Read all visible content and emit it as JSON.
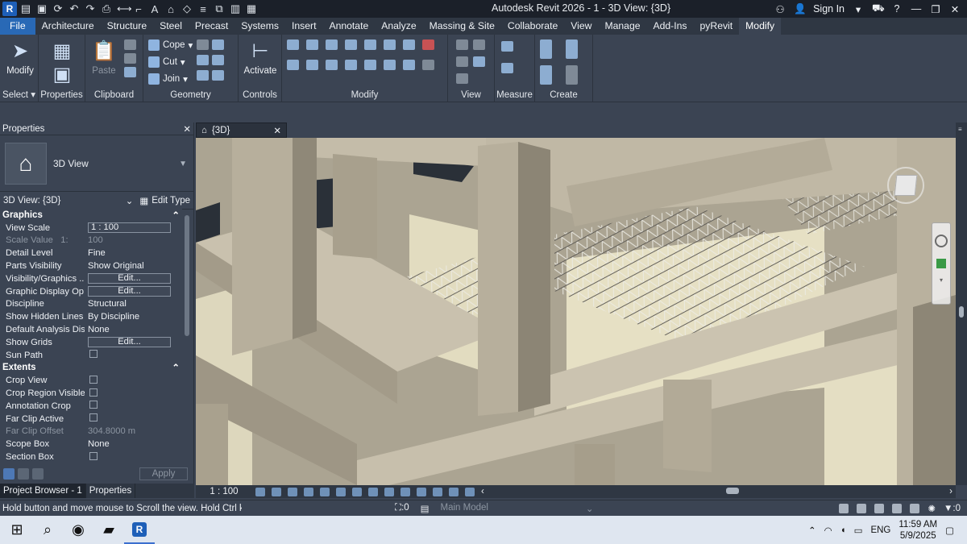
{
  "app": {
    "title": "Autodesk Revit 2026 - 1 - 3D View: {3D}",
    "logo_letter": "R",
    "sign_in": "Sign In"
  },
  "tabs": [
    "File",
    "Architecture",
    "Structure",
    "Steel",
    "Precast",
    "Systems",
    "Insert",
    "Annotate",
    "Analyze",
    "Massing & Site",
    "Collaborate",
    "View",
    "Manage",
    "Add-Ins",
    "pyRevit",
    "Modify"
  ],
  "active_tab": "Modify",
  "ribbon": {
    "select": {
      "modify_label": "Modify",
      "panel_label": "Select"
    },
    "properties": {
      "panel_label": "Properties"
    },
    "clipboard": {
      "paste_label": "Paste",
      "panel_label": "Clipboard"
    },
    "geometry": {
      "cope_label": "Cope",
      "cut_label": "Cut",
      "join_label": "Join",
      "panel_label": "Geometry"
    },
    "controls": {
      "activate_label": "Activate",
      "panel_label": "Controls"
    },
    "modify": {
      "panel_label": "Modify"
    },
    "view": {
      "panel_label": "View"
    },
    "measure": {
      "panel_label": "Measure"
    },
    "create": {
      "panel_label": "Create"
    }
  },
  "properties": {
    "header": "Properties",
    "type_name": "3D View",
    "instance": "3D View: {3D}",
    "edit_type": "Edit Type",
    "groups": {
      "graphics": "Graphics",
      "extents": "Extents"
    },
    "rows": {
      "view_scale": {
        "k": "View Scale",
        "v": "1 : 100"
      },
      "scale_value": {
        "k": "Scale Value",
        "k2": "1:",
        "v": "100"
      },
      "detail_level": {
        "k": "Detail Level",
        "v": "Fine"
      },
      "parts_visibility": {
        "k": "Parts Visibility",
        "v": "Show Original"
      },
      "visibility_graphics": {
        "k": "Visibility/Graphics ...",
        "v": "Edit..."
      },
      "graphic_display": {
        "k": "Graphic Display Op...",
        "v": "Edit..."
      },
      "discipline": {
        "k": "Discipline",
        "v": "Structural"
      },
      "show_hidden_lines": {
        "k": "Show Hidden Lines",
        "v": "By Discipline"
      },
      "default_analysis": {
        "k": "Default Analysis Dis...",
        "v": "None"
      },
      "show_grids": {
        "k": "Show Grids",
        "v": "Edit..."
      },
      "sun_path": {
        "k": "Sun Path"
      },
      "crop_view": {
        "k": "Crop View"
      },
      "crop_region_visible": {
        "k": "Crop Region Visible"
      },
      "annotation_crop": {
        "k": "Annotation Crop"
      },
      "far_clip_active": {
        "k": "Far Clip Active"
      },
      "far_clip_offset": {
        "k": "Far Clip Offset",
        "v": "304.8000 m"
      },
      "scope_box": {
        "k": "Scope Box",
        "v": "None"
      },
      "section_box": {
        "k": "Section Box"
      }
    },
    "apply": "Apply"
  },
  "browser_tabs": [
    "Project Browser - 1",
    "Properties"
  ],
  "view_tab": {
    "label": "{3D}"
  },
  "view_control": {
    "scale": "1 : 100"
  },
  "status": {
    "text": "Hold button and move mouse to Scroll the view. Hold Ctrl key t",
    "worksets": ":0",
    "model": "Main Model",
    "filter_count": ":0"
  },
  "taskbar": {
    "lang": "ENG",
    "time": "11:59 AM",
    "date": "5/9/2025"
  }
}
